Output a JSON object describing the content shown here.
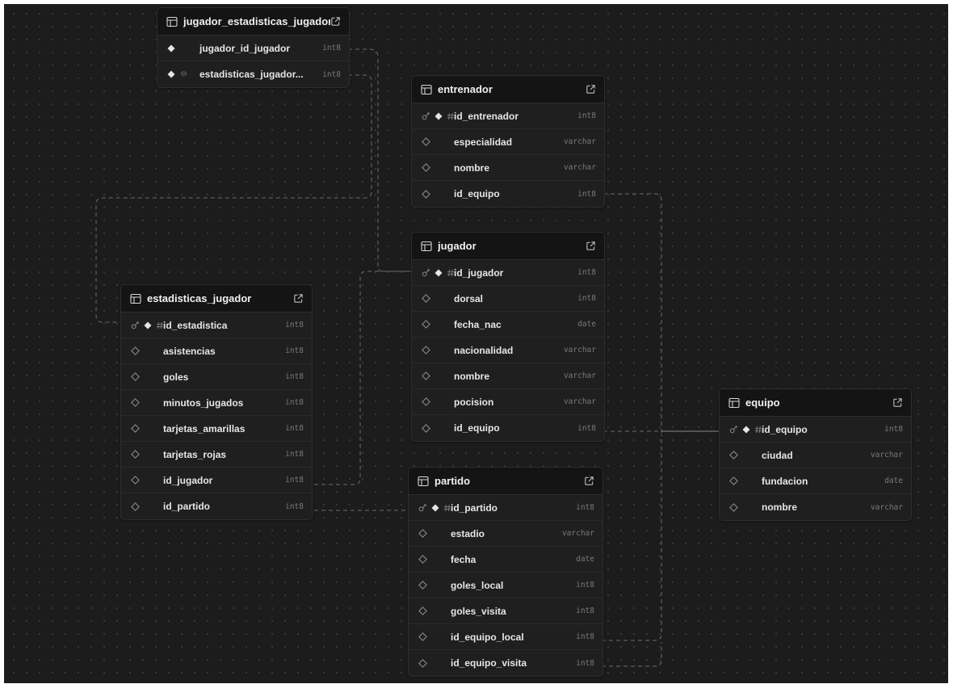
{
  "tables": [
    {
      "id": "jugador_estadisticas_jugadores",
      "name": "jugador_estadisticas_jugadores",
      "columns": [
        {
          "name": "jugador_id_jugador",
          "type": "int8",
          "icons": [
            "diamond-filled"
          ]
        },
        {
          "name": "estadisticas_jugador...",
          "type": "int8",
          "icons": [
            "diamond-filled",
            "fingerprint"
          ]
        }
      ]
    },
    {
      "id": "entrenador",
      "name": "entrenador",
      "columns": [
        {
          "name": "id_entrenador",
          "type": "int8",
          "icons": [
            "key",
            "diamond-filled",
            "hash"
          ]
        },
        {
          "name": "especialidad",
          "type": "varchar",
          "icons": [
            "diamond-outline"
          ]
        },
        {
          "name": "nombre",
          "type": "varchar",
          "icons": [
            "diamond-outline"
          ]
        },
        {
          "name": "id_equipo",
          "type": "int8",
          "icons": [
            "diamond-outline"
          ]
        }
      ]
    },
    {
      "id": "jugador",
      "name": "jugador",
      "columns": [
        {
          "name": "id_jugador",
          "type": "int8",
          "icons": [
            "key",
            "diamond-filled",
            "hash"
          ]
        },
        {
          "name": "dorsal",
          "type": "int8",
          "icons": [
            "diamond-outline"
          ]
        },
        {
          "name": "fecha_nac",
          "type": "date",
          "icons": [
            "diamond-outline"
          ]
        },
        {
          "name": "nacionalidad",
          "type": "varchar",
          "icons": [
            "diamond-outline"
          ]
        },
        {
          "name": "nombre",
          "type": "varchar",
          "icons": [
            "diamond-outline"
          ]
        },
        {
          "name": "pocision",
          "type": "varchar",
          "icons": [
            "diamond-outline"
          ]
        },
        {
          "name": "id_equipo",
          "type": "int8",
          "icons": [
            "diamond-outline"
          ]
        }
      ]
    },
    {
      "id": "estadisticas_jugador",
      "name": "estadisticas_jugador",
      "columns": [
        {
          "name": "id_estadistica",
          "type": "int8",
          "icons": [
            "key",
            "diamond-filled",
            "hash"
          ]
        },
        {
          "name": "asistencias",
          "type": "int8",
          "icons": [
            "diamond-outline"
          ]
        },
        {
          "name": "goles",
          "type": "int8",
          "icons": [
            "diamond-outline"
          ]
        },
        {
          "name": "minutos_jugados",
          "type": "int8",
          "icons": [
            "diamond-outline"
          ]
        },
        {
          "name": "tarjetas_amarillas",
          "type": "int8",
          "icons": [
            "diamond-outline"
          ]
        },
        {
          "name": "tarjetas_rojas",
          "type": "int8",
          "icons": [
            "diamond-outline"
          ]
        },
        {
          "name": "id_jugador",
          "type": "int8",
          "icons": [
            "diamond-outline"
          ]
        },
        {
          "name": "id_partido",
          "type": "int8",
          "icons": [
            "diamond-outline"
          ]
        }
      ]
    },
    {
      "id": "partido",
      "name": "partido",
      "columns": [
        {
          "name": "id_partido",
          "type": "int8",
          "icons": [
            "key",
            "diamond-filled",
            "hash"
          ]
        },
        {
          "name": "estadio",
          "type": "varchar",
          "icons": [
            "diamond-outline"
          ]
        },
        {
          "name": "fecha",
          "type": "date",
          "icons": [
            "diamond-outline"
          ]
        },
        {
          "name": "goles_local",
          "type": "int8",
          "icons": [
            "diamond-outline"
          ]
        },
        {
          "name": "goles_visita",
          "type": "int8",
          "icons": [
            "diamond-outline"
          ]
        },
        {
          "name": "id_equipo_local",
          "type": "int8",
          "icons": [
            "diamond-outline"
          ]
        },
        {
          "name": "id_equipo_visita",
          "type": "int8",
          "icons": [
            "diamond-outline"
          ]
        }
      ]
    },
    {
      "id": "equipo",
      "name": "equipo",
      "columns": [
        {
          "name": "id_equipo",
          "type": "int8",
          "icons": [
            "key",
            "diamond-filled",
            "hash"
          ]
        },
        {
          "name": "ciudad",
          "type": "varchar",
          "icons": [
            "diamond-outline"
          ]
        },
        {
          "name": "fundacion",
          "type": "date",
          "icons": [
            "diamond-outline"
          ]
        },
        {
          "name": "nombre",
          "type": "varchar",
          "icons": [
            "diamond-outline"
          ]
        }
      ]
    }
  ],
  "colors": {
    "canvas": "#1c1c1c",
    "header": "#141414",
    "edge": "#6b6b6b",
    "solid_edge": "#8a8a8a"
  }
}
